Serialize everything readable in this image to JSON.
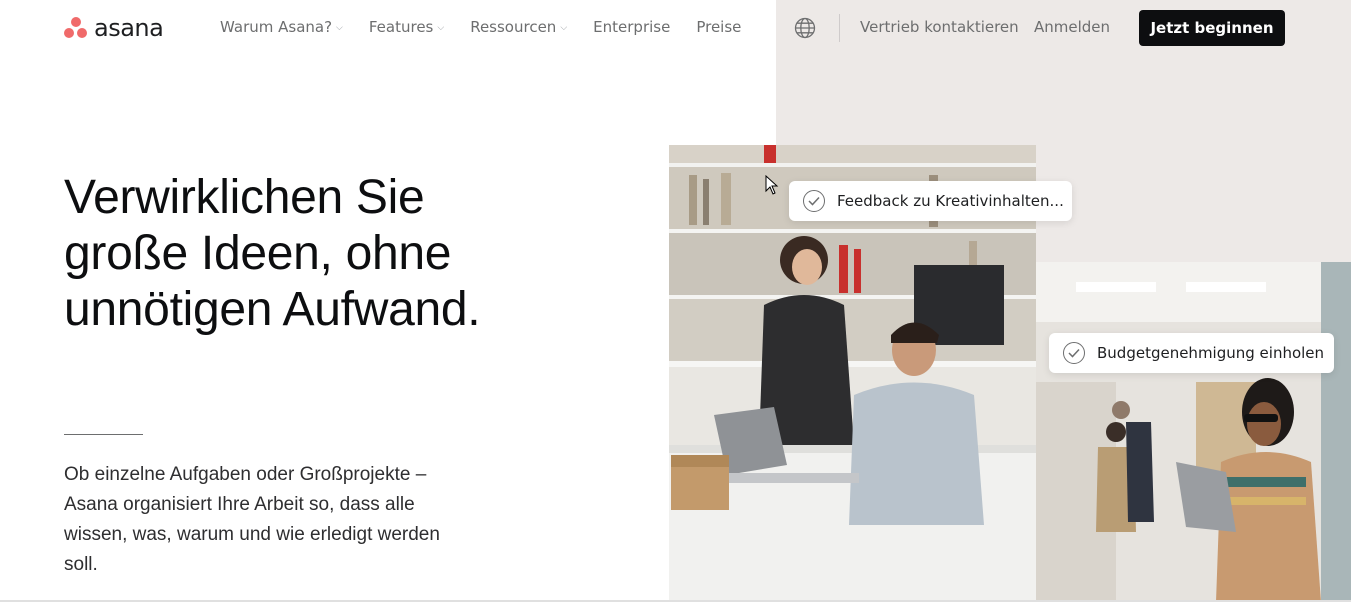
{
  "brand": {
    "name": "asana",
    "accent": "#f06a6a"
  },
  "nav": {
    "items": [
      {
        "label": "Warum Asana?",
        "has_dropdown": true
      },
      {
        "label": "Features",
        "has_dropdown": true
      },
      {
        "label": "Ressourcen",
        "has_dropdown": true
      },
      {
        "label": "Enterprise",
        "has_dropdown": false
      },
      {
        "label": "Preise",
        "has_dropdown": false
      }
    ],
    "language_icon": "globe-icon",
    "contact_sales": "Vertrieb kontaktieren",
    "login": "Anmelden",
    "cta": "Jetzt beginnen"
  },
  "hero": {
    "headline_lines": [
      "Verwirklichen Sie",
      "große Ideen, ohne",
      "unnötigen Aufwand."
    ],
    "subtext": "Ob einzelne Aufgaben oder Großprojekte – Asana organisiert Ihre Arbeit so, dass alle wissen, was, warum und wie erledigt werden soll."
  },
  "task_cards": [
    {
      "label": "Feedback zu Kreativinhalten..."
    },
    {
      "label": "Budgetgenehmigung einholen"
    }
  ],
  "colors": {
    "panel_bg": "#ede9e7",
    "cta_bg": "#0d0e10",
    "nav_text": "#6d6e6f"
  }
}
